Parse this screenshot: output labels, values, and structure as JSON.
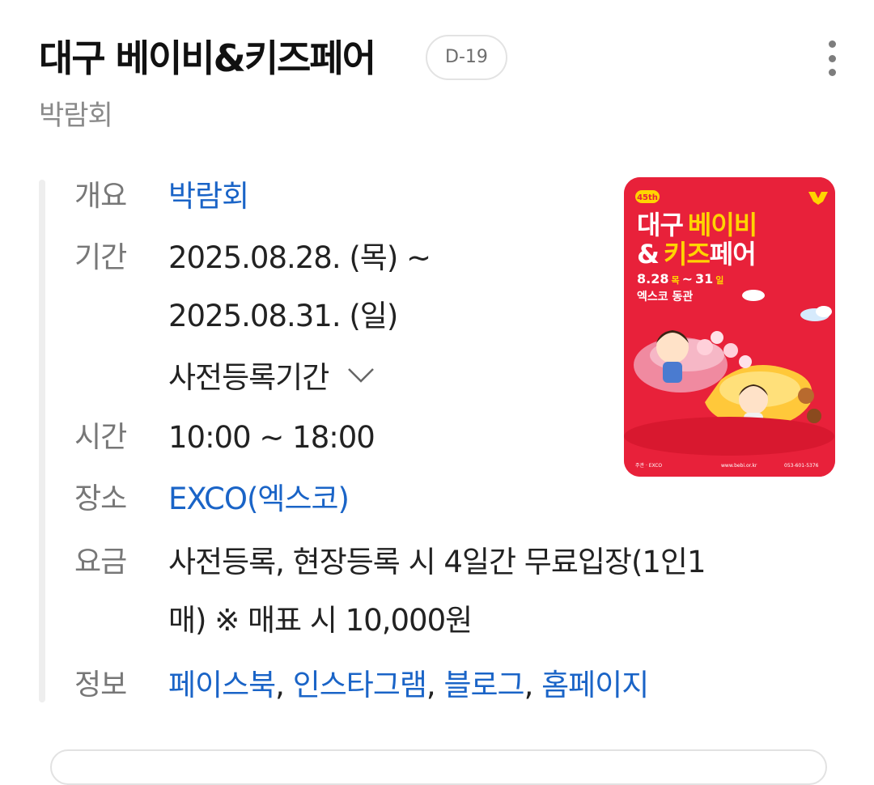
{
  "header": {
    "title": "대구 베이비&키즈페어",
    "dday": "D-19",
    "category": "박람회"
  },
  "info": {
    "overview": {
      "label": "개요",
      "value": "박람회"
    },
    "period": {
      "label": "기간",
      "line1": "2025.08.28. (목) ~",
      "line2": "2025.08.31. (일)",
      "pre_registration": "사전등록기간"
    },
    "time": {
      "label": "시간",
      "value": "10:00 ~ 18:00"
    },
    "venue": {
      "label": "장소",
      "value": "EXCO(엑스코)"
    },
    "fee": {
      "label": "요금",
      "line1": "사전등록, 현장등록 시 4일간 무료입장(1인1",
      "line2": "매) ※ 매표 시 10,000원"
    },
    "links": {
      "label": "정보",
      "items": [
        "페이스북",
        "인스타그램",
        "블로그",
        "홈페이지"
      ],
      "separator": ","
    }
  },
  "poster": {
    "edition": "45th",
    "title_part1": "대구",
    "title_highlight1": "베이비",
    "title_line2_part1": "&",
    "title_highlight2": "키즈",
    "title_line2_part2": "페어",
    "date_start": "8.28",
    "date_start_day": "목",
    "date_dash": "~",
    "date_end": "31",
    "date_end_day": "일",
    "venue": "엑스코 동관",
    "website": "www.bebi.or.kr",
    "phone": "053-601-5376",
    "colors": {
      "background": "#e8213a",
      "highlight": "#ffd400",
      "text": "#ffffff"
    }
  },
  "theme": {
    "link_color": "#1a64c7",
    "label_color": "#777777"
  }
}
